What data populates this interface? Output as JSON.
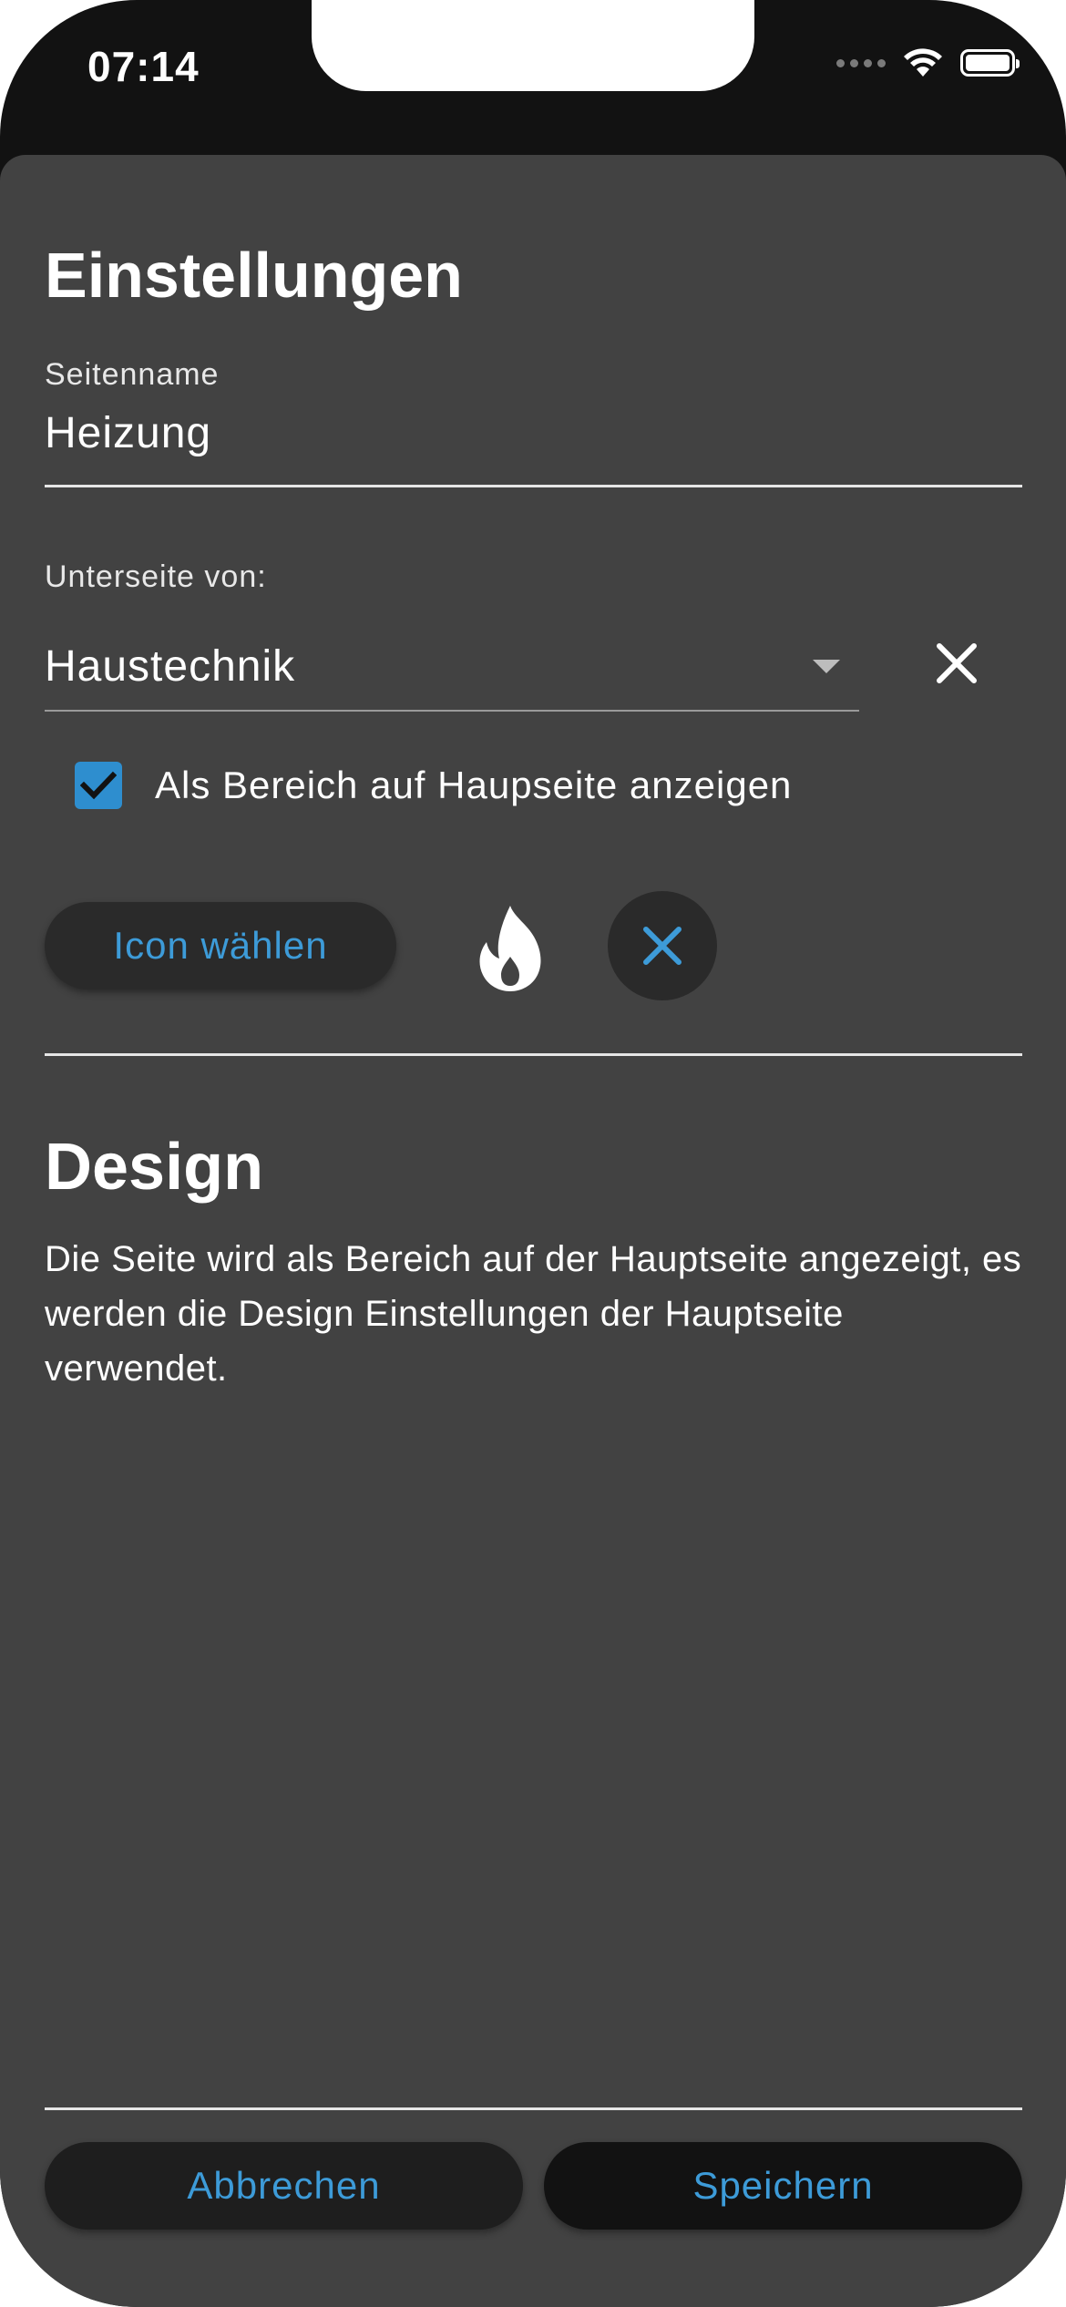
{
  "status_bar": {
    "time": "07:14"
  },
  "settings": {
    "title": "Einstellungen",
    "page_name_label": "Seitenname",
    "page_name_value": "Heizung",
    "parent_label": "Unterseite von:",
    "parent_value": "Haustechnik",
    "show_as_area_label": "Als Bereich auf Haupseite anzeigen",
    "show_as_area_checked": true,
    "choose_icon_label": "Icon wählen",
    "selected_icon": "fire-icon"
  },
  "design": {
    "title": "Design",
    "description": "Die Seite wird als Bereich auf der Hauptseite angezeigt, es werden die Design Einstellungen der Hauptseite verwendet."
  },
  "footer": {
    "cancel_label": "Abbrechen",
    "save_label": "Speichern"
  },
  "colors": {
    "accent": "#3d9bd8",
    "sheet_background": "#424242",
    "checkbox": "#2e8ecf"
  }
}
